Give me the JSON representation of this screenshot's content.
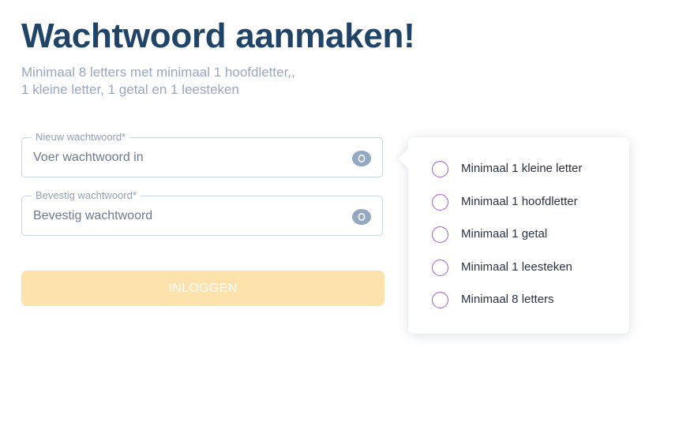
{
  "heading": "Wachtwoord aanmaken!",
  "subtitle": {
    "line1": "Minimaal 8 letters met minimaal 1 hoofdletter,,",
    "line2": "1 kleine letter, 1 getal en 1 leesteken"
  },
  "new_password": {
    "label": "Nieuw wachtwoord*",
    "placeholder": "Voer wachtwoord in",
    "value": "",
    "toggle_icon": "eye-icon"
  },
  "confirm_password": {
    "label": "Bevestig wachtwoord*",
    "placeholder": "Bevestig wachtwoord",
    "value": "",
    "toggle_icon": "eye-icon"
  },
  "submit": {
    "label": "INLOGGEN",
    "enabled": false
  },
  "requirements": [
    {
      "label": "Minimaal 1 kleine letter",
      "met": false
    },
    {
      "label": "Minimaal 1 hoofdletter",
      "met": false
    },
    {
      "label": "Minimaal 1 getal",
      "met": false
    },
    {
      "label": "Minimaal 1 leesteken",
      "met": false
    },
    {
      "label": "Minimaal 8 letters",
      "met": false
    }
  ],
  "colors": {
    "heading": "#1f4468",
    "subtitle": "#9aa6bd",
    "field_border": "#c7d7e6",
    "button_disabled": "#fde2ac",
    "requirement_circle": "#a45ad8",
    "eye_icon": "#93a8c2"
  }
}
